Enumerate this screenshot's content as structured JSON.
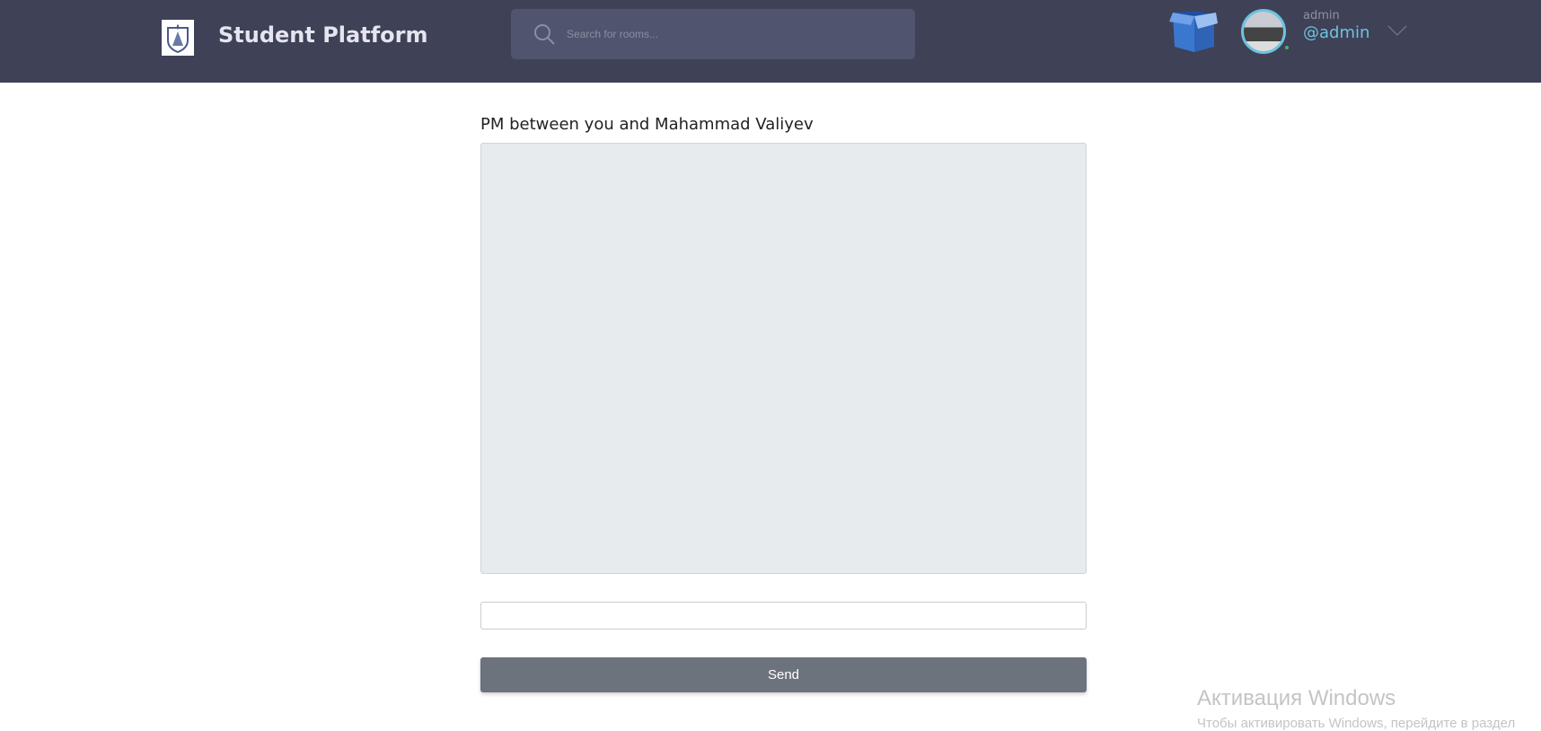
{
  "header": {
    "app_title": "Student Platform",
    "search_placeholder": "Search for rooms...",
    "user": {
      "name": "admin",
      "handle": "@admin"
    }
  },
  "main": {
    "title": "PM between you and Mahammad Valiyev",
    "message_value": "",
    "send_label": "Send"
  },
  "watermark": {
    "line1": "Активация Windows",
    "line2": "Чтобы активировать Windows, перейдите в раздел"
  }
}
